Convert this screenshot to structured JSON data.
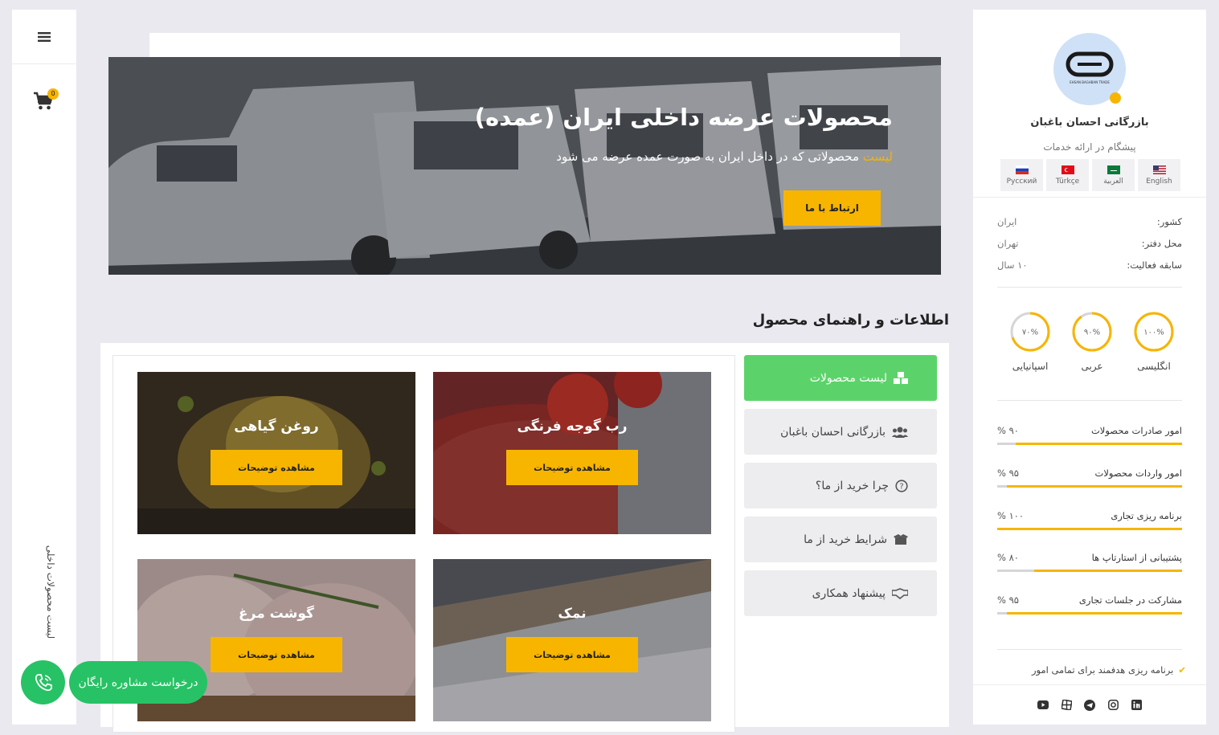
{
  "rail": {
    "cart_count": "0",
    "vertical_label": "لیست محصولات داخلی"
  },
  "hero": {
    "title": "محصولات عرضه داخلی ایران (عمده)",
    "subtitle_highlight": "لیست",
    "subtitle_rest": " محصولاتی که در داخل ایران به صورت عمده عرضه می شود",
    "contact_button": "ارتباط با ما"
  },
  "section": {
    "title": "اطلاعات و راهنمای محصول"
  },
  "products": [
    {
      "title": "رب گوجه فرنگی",
      "button": "مشاهده توضیحات"
    },
    {
      "title": "روغن گیاهی",
      "button": "مشاهده توضیحات"
    },
    {
      "title": "نمک",
      "button": "مشاهده توضیحات"
    },
    {
      "title": "گوشت مرغ",
      "button": "مشاهده توضیحات"
    }
  ],
  "side_menu": [
    {
      "label": "لیست محصولات",
      "icon": "boxes-icon",
      "active": true
    },
    {
      "label": "بازرگانی احسان باغبان",
      "icon": "users-icon",
      "active": false
    },
    {
      "label": "چرا خرید از ما؟",
      "icon": "question-circle-icon",
      "active": false
    },
    {
      "label": "شرایط خرید از ما",
      "icon": "box-open-icon",
      "active": false
    },
    {
      "label": "پیشنهاد همکاری",
      "icon": "handshake-icon",
      "active": false
    }
  ],
  "profile": {
    "name": "بازرگانی احسان باغبان",
    "tagline": "پیشگام در ارائه خدمات",
    "logo_text": "EHSAN BAGHBAN TRADE",
    "languages": [
      {
        "label": "Русский",
        "flag": "ru"
      },
      {
        "label": "Türkçe",
        "flag": "tr"
      },
      {
        "label": "العربية",
        "flag": "sa"
      },
      {
        "label": "English",
        "flag": "us"
      }
    ],
    "info": [
      {
        "key": "کشور:",
        "value": "ایران"
      },
      {
        "key": "محل دفتر:",
        "value": "تهران"
      },
      {
        "key": "سابقه فعالیت:",
        "value": "۱۰ سال"
      }
    ],
    "language_skills": [
      {
        "label": "انگلیسی",
        "value_text": "۱۰۰%",
        "percent": 100
      },
      {
        "label": "عربی",
        "value_text": "۹۰%",
        "percent": 90
      },
      {
        "label": "اسپانیایی",
        "value_text": "۷۰%",
        "percent": 70
      }
    ],
    "services": [
      {
        "label": "امور صادرات محصولات",
        "value_text": "% ۹۰",
        "percent": 90
      },
      {
        "label": "امور واردات محصولات",
        "value_text": "% ۹۵",
        "percent": 95
      },
      {
        "label": "برنامه ریزی تجاری",
        "value_text": "% ۱۰۰",
        "percent": 100
      },
      {
        "label": "پشتیبانی از استارتاپ ها",
        "value_text": "% ۸۰",
        "percent": 80
      },
      {
        "label": "مشارکت در جلسات تجاری",
        "value_text": "% ۹۵",
        "percent": 95
      }
    ],
    "check_item": "برنامه ریزی هدفمند برای تمامی امور",
    "socials": [
      "youtube-icon",
      "grid-icon",
      "telegram-icon",
      "instagram-icon",
      "linkedin-icon"
    ]
  },
  "consult": {
    "label": "درخواست مشاوره رایگان"
  },
  "colors": {
    "accent": "#f7b500",
    "green": "#5cd36a",
    "consult_green": "#27c265"
  }
}
